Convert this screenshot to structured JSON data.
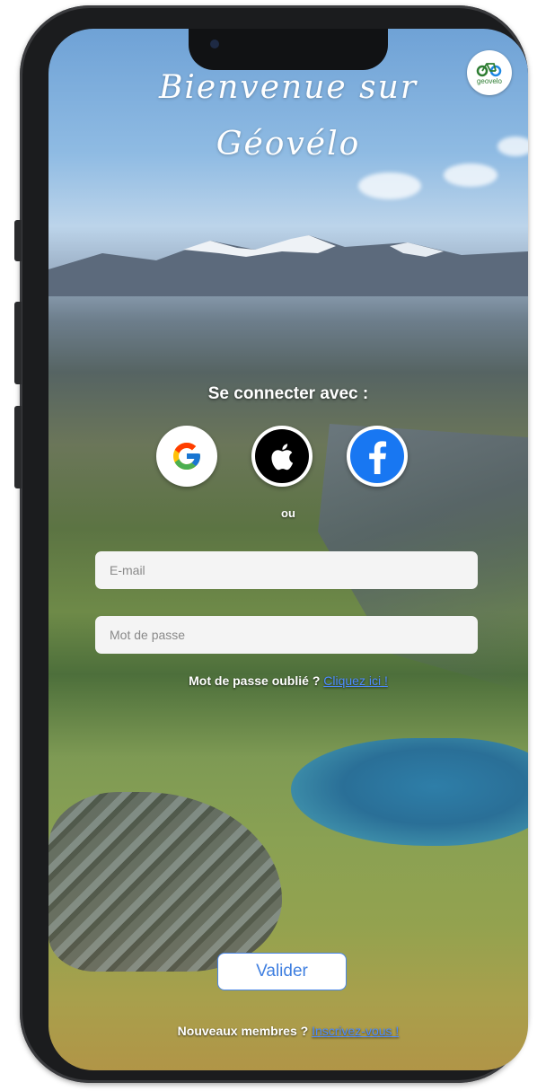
{
  "header": {
    "title_line1": "Bienvenue sur",
    "title_line2": "Géovélo",
    "logo_text": "geovelo"
  },
  "social_login": {
    "label": "Se connecter avec :",
    "providers": [
      "google",
      "apple",
      "facebook"
    ],
    "separator": "ou"
  },
  "form": {
    "email_placeholder": "E-mail",
    "password_placeholder": "Mot de passe",
    "email_value": "",
    "password_value": ""
  },
  "forgot": {
    "text": "Mot de passe oublié ?",
    "link_text": "Cliquez ici !"
  },
  "submit": {
    "label": "Valider"
  },
  "signup": {
    "text": "Nouveaux membres ?",
    "link_text": "Inscrivez-vous !"
  },
  "colors": {
    "accent": "#4a86e8",
    "link": "#4e8cff",
    "logo_green": "#2e7d32",
    "logo_blue": "#1e88e5",
    "facebook_blue": "#1877f2"
  },
  "icons": {
    "logo": "bicycle-icon",
    "google": "google-icon",
    "apple": "apple-icon",
    "facebook": "facebook-icon"
  }
}
